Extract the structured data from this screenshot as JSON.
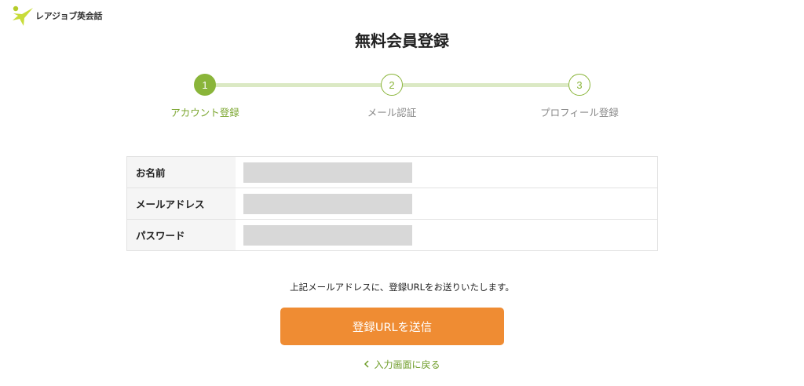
{
  "logo": {
    "text": "レアジョブ英会話",
    "brand_color": "#c1d62e"
  },
  "page": {
    "title": "無料会員登録"
  },
  "steps": [
    {
      "number": "1",
      "label": "アカウント登録",
      "active": true
    },
    {
      "number": "2",
      "label": "メール認証",
      "active": false
    },
    {
      "number": "3",
      "label": "プロフィール登録",
      "active": false
    }
  ],
  "colors": {
    "accent_green": "#8ab53a",
    "button_orange": "#ef8c33",
    "step_line": "#dbe9c4"
  },
  "form": {
    "rows": [
      {
        "label": "お名前",
        "value": ""
      },
      {
        "label": "メールアドレス",
        "value": ""
      },
      {
        "label": "パスワード",
        "value": ""
      }
    ]
  },
  "note": "上記メールアドレスに、登録URLをお送りいたします。",
  "submit_label": "登録URLを送信",
  "back": {
    "icon": "chevron-left-icon",
    "label": "入力画面に戻る"
  }
}
